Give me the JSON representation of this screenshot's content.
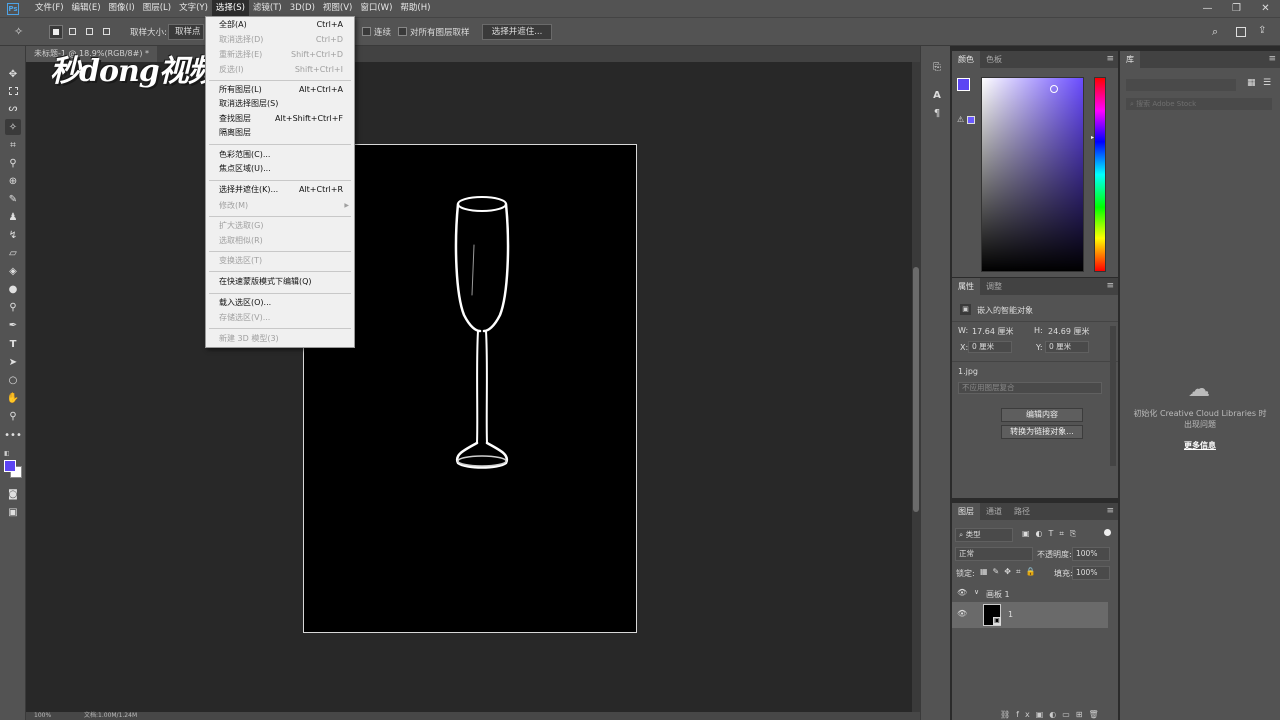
{
  "app": {
    "logo": "Ps"
  },
  "menubar": {
    "items": [
      "文件(F)",
      "编辑(E)",
      "图像(I)",
      "图层(L)",
      "文字(Y)",
      "选择(S)",
      "滤镜(T)",
      "3D(D)",
      "视图(V)",
      "窗口(W)",
      "帮助(H)"
    ],
    "active_index": 5,
    "window_controls": [
      "minimize-icon",
      "restore-icon",
      "close-icon"
    ]
  },
  "options_bar": {
    "sample_size_label": "取样大小:",
    "sample_size_value": "取样点",
    "contiguous_label": "连续",
    "all_layers_label": "对所有图层取样",
    "select_and_mask_label": "选择并遮住..."
  },
  "document": {
    "tab_title": "未标题-1 @ 18.9%(RGB/8#) *",
    "status_zoom": "100%",
    "status_doc": "文档:1.00M/1.24M"
  },
  "watermark": {
    "text": "秒dong视频"
  },
  "select_menu": {
    "items": [
      {
        "label": "全部(A)",
        "shortcut": "Ctrl+A",
        "disabled": false
      },
      {
        "label": "取消选择(D)",
        "shortcut": "Ctrl+D",
        "disabled": true
      },
      {
        "label": "重新选择(E)",
        "shortcut": "Shift+Ctrl+D",
        "disabled": true
      },
      {
        "label": "反选(I)",
        "shortcut": "Shift+Ctrl+I",
        "disabled": true
      },
      {
        "label": "所有图层(L)",
        "shortcut": "Alt+Ctrl+A",
        "disabled": false
      },
      {
        "label": "取消选择图层(S)",
        "shortcut": "",
        "disabled": false
      },
      {
        "label": "查找图层",
        "shortcut": "Alt+Shift+Ctrl+F",
        "disabled": false
      },
      {
        "label": "隔离图层",
        "shortcut": "",
        "disabled": false
      },
      {
        "label": "色彩范围(C)...",
        "shortcut": "",
        "disabled": false
      },
      {
        "label": "焦点区域(U)...",
        "shortcut": "",
        "disabled": false
      },
      {
        "label": "选择并遮住(K)...",
        "shortcut": "Alt+Ctrl+R",
        "disabled": false
      },
      {
        "label": "修改(M)",
        "shortcut": "",
        "disabled": true,
        "submenu": true
      },
      {
        "label": "扩大选取(G)",
        "shortcut": "",
        "disabled": true
      },
      {
        "label": "选取相似(R)",
        "shortcut": "",
        "disabled": true
      },
      {
        "label": "变换选区(T)",
        "shortcut": "",
        "disabled": true
      },
      {
        "label": "在快速蒙版模式下编辑(Q)",
        "shortcut": "",
        "disabled": false
      },
      {
        "label": "载入选区(O)...",
        "shortcut": "",
        "disabled": false
      },
      {
        "label": "存储选区(V)...",
        "shortcut": "",
        "disabled": true
      },
      {
        "label": "新建 3D 模型(3)",
        "shortcut": "",
        "disabled": true
      }
    ]
  },
  "color_panel": {
    "tabs": [
      "颜色",
      "色板"
    ],
    "foreground": "#5c45f3",
    "background": "#ffffff"
  },
  "properties_panel": {
    "tabs": [
      "属性",
      "调整"
    ],
    "object_type": "嵌入的智能对象",
    "w_label": "W:",
    "w_value": "17.64 厘米",
    "h_label": "H:",
    "h_value": "24.69 厘米",
    "x_label": "X:",
    "x_value": "0 厘米",
    "y_label": "Y:",
    "y_value": "0 厘米",
    "filename": "1.jpg",
    "comp_placeholder": "不应用图层复合",
    "edit_contents": "编辑内容",
    "convert_linked": "转换为链接对象..."
  },
  "layers_panel": {
    "tabs": [
      "图层",
      "通道",
      "路径"
    ],
    "filter_label": "类型",
    "blend_mode": "正常",
    "opacity_label": "不透明度:",
    "opacity_value": "100%",
    "lock_label": "锁定:",
    "fill_label": "填充:",
    "fill_value": "100%",
    "artboard_name": "画板 1",
    "layer_name": "1"
  },
  "library_panel": {
    "tab": "库",
    "search_placeholder": "搜索 Adobe Stock",
    "message": "初始化 Creative Cloud Libraries 时出现问题",
    "more_info": "更多信息"
  }
}
